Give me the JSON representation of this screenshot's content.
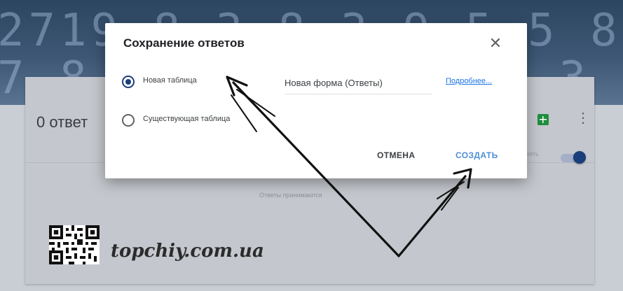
{
  "background": {
    "header_digits": "2719 8 3 8 3 9 5 5 8 6 1 5 7 5\n7 8 8 2 5 2 5 7 6 3 3 6 7 9 3"
  },
  "card": {
    "responses_count": "0 ответ",
    "accepting_label": "нять",
    "status_text": "Ответы принимаются"
  },
  "dialog": {
    "title": "Сохранение ответов",
    "close_icon": "close-icon",
    "options": [
      {
        "label": "Новая таблица",
        "checked": true
      },
      {
        "label": "Существующая таблица",
        "checked": false
      }
    ],
    "spreadsheet_name": "Новая форма (Ответы)",
    "more_link": "Подробнее...",
    "cancel_label": "ОТМЕНА",
    "create_label": "СОЗДАТЬ"
  },
  "watermark": {
    "text": "topchiy.com.ua"
  },
  "colors": {
    "accent": "#1a3d7c",
    "link": "#1a73e8",
    "create_button": "#4f8fd6",
    "sheets_green": "#1e8e3e"
  }
}
